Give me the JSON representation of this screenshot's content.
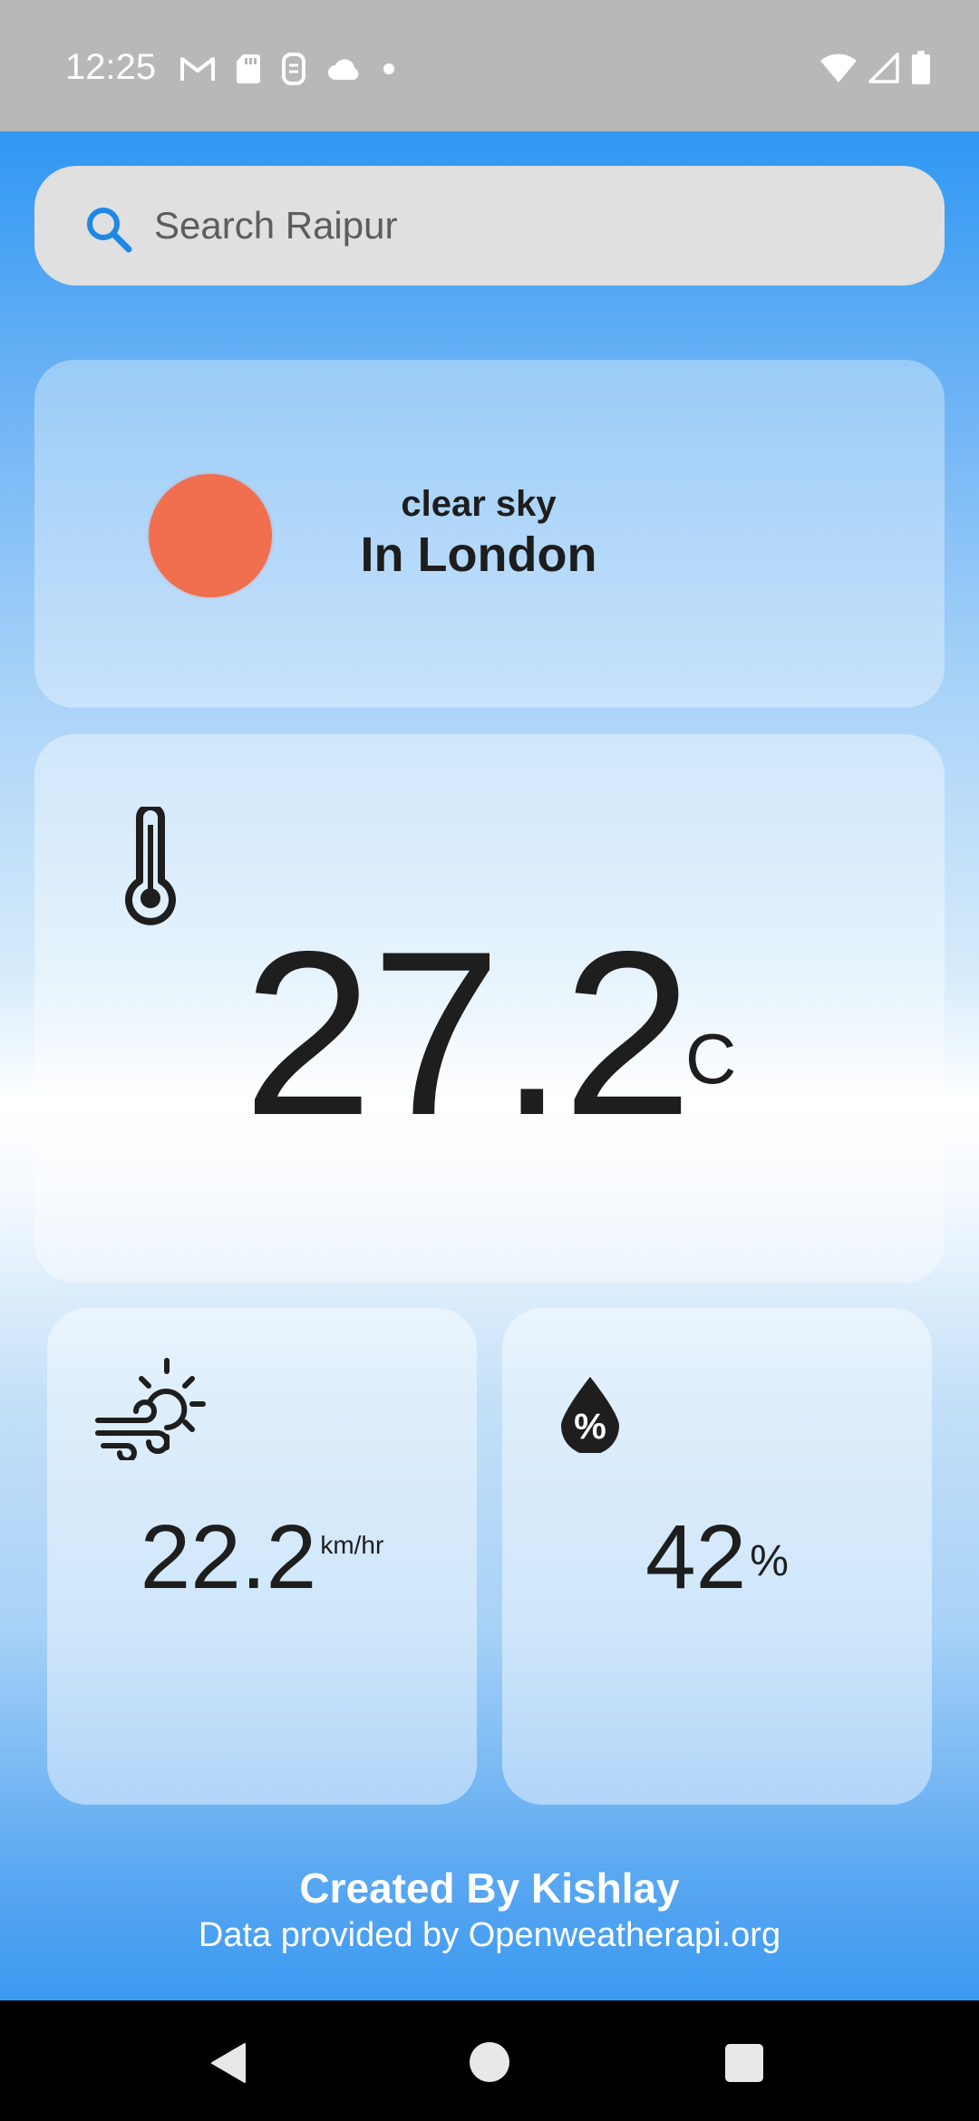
{
  "status_bar": {
    "time": "12:25",
    "left_icons": [
      "gmail-icon",
      "sd-card-icon",
      "app-notification-icon",
      "cloud-icon",
      "dot-icon"
    ],
    "right_icons": [
      "wifi-icon",
      "signal-icon",
      "battery-icon"
    ]
  },
  "search": {
    "placeholder": "Search Raipur",
    "value": ""
  },
  "weather": {
    "description": "clear sky",
    "location": "In London",
    "icon_color": "#ef6f4f"
  },
  "temperature": {
    "value": "27.2",
    "unit": "C"
  },
  "wind": {
    "value": "22.2",
    "unit": "km/hr"
  },
  "humidity": {
    "value": "42",
    "unit": "%"
  },
  "footer": {
    "title": "Created By Kishlay",
    "subtitle": "Data provided by Openweatherapi.org"
  },
  "nav": {
    "buttons": [
      "back",
      "home",
      "recents"
    ]
  },
  "colors": {
    "accent_search_icon": "#1e88e5",
    "gradient_top": "#2f97f3",
    "gradient_bottom": "#3b99f0"
  }
}
